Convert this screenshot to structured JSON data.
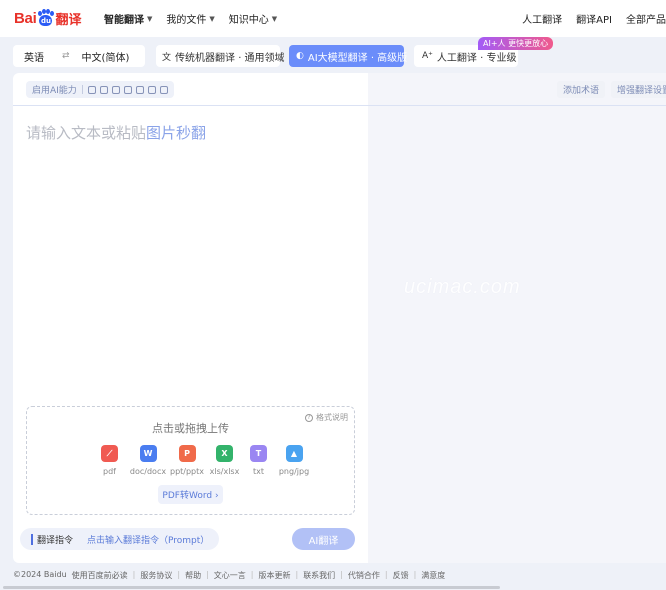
{
  "brand": {
    "bai": "Bai",
    "du": "du",
    "fanyi": "翻译"
  },
  "nav": {
    "items": [
      {
        "label": "智能翻译",
        "active": true
      },
      {
        "label": "我的文件"
      },
      {
        "label": "知识中心"
      }
    ],
    "right": [
      "人工翻译",
      "翻译API",
      "全部产品"
    ]
  },
  "toolbar": {
    "source_lang": "英语",
    "swap": "⇄",
    "target_lang": "中文(简体)",
    "modes": [
      {
        "icon": "文",
        "label": "传统机器翻译 · 通用领域"
      },
      {
        "icon": "◐",
        "label": "AI大模型翻译 · 高级版"
      },
      {
        "icon": "A⁺",
        "label": "人工翻译 · 专业级"
      }
    ],
    "badge": "AI+人 更快更放心"
  },
  "options": {
    "label": "启用AI能力",
    "sep": "|"
  },
  "right_buttons": [
    "添加术语",
    "增强翻译设置"
  ],
  "input": {
    "placeholder_a": "请输入文本或粘贴",
    "placeholder_b": "图片秒翻"
  },
  "watermark": "ucimac.com",
  "upload": {
    "title": "点击或拖拽上传",
    "format_help": "格式说明",
    "types": [
      {
        "label": "pdf",
        "color": "#f05a52",
        "glyph": "⟋"
      },
      {
        "label": "doc/docx",
        "color": "#4a7df0",
        "glyph": "W"
      },
      {
        "label": "ppt/pptx",
        "color": "#f06a4a",
        "glyph": "P"
      },
      {
        "label": "xls/xlsx",
        "color": "#33b36b",
        "glyph": "X"
      },
      {
        "label": "txt",
        "color": "#9a86f2",
        "glyph": "T"
      },
      {
        "label": "png/jpg",
        "color": "#4aa3f0",
        "glyph": "▲"
      }
    ],
    "pdf_word": "PDF转Word ›"
  },
  "prompt": {
    "label": "翻译指令",
    "placeholder": "点击输入翻译指令（Prompt）"
  },
  "ai_button": "AI翻译",
  "footer": [
    "©2024 Baidu",
    "使用百度前必读",
    "服务协议",
    "帮助",
    "文心一言",
    "版本更新",
    "联系我们",
    "代销合作",
    "反馈",
    "满意度"
  ]
}
